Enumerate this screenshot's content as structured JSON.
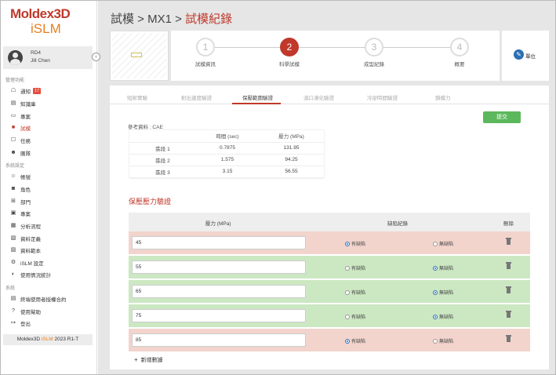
{
  "brand": {
    "line1": "Moldex3D",
    "line2": "iSLM"
  },
  "user": {
    "org": "RD4",
    "name": "Jill Chen"
  },
  "sidebar": {
    "section_management": "管理功能",
    "management_items": [
      {
        "label": "通知",
        "icon": "bell-icon",
        "badge": "17"
      },
      {
        "label": "知識庫",
        "icon": "book-icon"
      },
      {
        "label": "專案",
        "icon": "folder-icon"
      },
      {
        "label": "試模",
        "icon": "trial-icon",
        "active": true
      },
      {
        "label": "任務",
        "icon": "task-icon"
      },
      {
        "label": "團隊",
        "icon": "team-icon"
      }
    ],
    "section_system": "系統設定",
    "system_items": [
      {
        "label": "帳號",
        "icon": "account-icon"
      },
      {
        "label": "角色",
        "icon": "role-icon"
      },
      {
        "label": "部門",
        "icon": "department-icon"
      },
      {
        "label": "專案",
        "icon": "project-settings-icon"
      },
      {
        "label": "分析流程",
        "icon": "flow-icon"
      },
      {
        "label": "資料定義",
        "icon": "data-definition-icon"
      },
      {
        "label": "資料範本",
        "icon": "template-icon"
      },
      {
        "label": "iSLM 設定",
        "icon": "settings-icon"
      },
      {
        "label": "使用情況統計",
        "icon": "stats-icon"
      }
    ],
    "section_system2": "系統",
    "system2_items": [
      {
        "label": "終端使用者授權合約",
        "icon": "license-icon"
      },
      {
        "label": "使用幫助",
        "icon": "help-icon"
      },
      {
        "label": "登出",
        "icon": "logout-icon"
      }
    ],
    "version_prefix": "Moldex3D ",
    "version_brand": "iSLM",
    "version_suffix": " 2023 R1-T"
  },
  "breadcrumb": {
    "part1": "試模",
    "sep1": " > ",
    "part2": "MX1",
    "sep2": " > ",
    "current": "試模紀錄"
  },
  "steps": [
    {
      "number": "1",
      "label": "試模資訊"
    },
    {
      "number": "2",
      "label": "科學試模",
      "active": true
    },
    {
      "number": "3",
      "label": "成型紀錄"
    },
    {
      "number": "4",
      "label": "概要"
    }
  ],
  "unit_button": "單位",
  "tabs": [
    "短射實驗",
    "射出速度驗證",
    "保壓範圍驗證",
    "澆口凍化驗證",
    "冷卻時間驗證",
    "鎖模力"
  ],
  "active_tab": 2,
  "submit_label": "提交",
  "reference_label": "參考資料 : CAE",
  "ref_table": {
    "headers": [
      "",
      "時間 (sec)",
      "壓力 (MPa)"
    ],
    "rows": [
      [
        "區段 1",
        "0.7875",
        "131.95"
      ],
      [
        "區段 2",
        "1.575",
        "94.25"
      ],
      [
        "區段 3",
        "3.15",
        "56.55"
      ]
    ]
  },
  "section_title": "保壓壓力驗證",
  "pressure_table": {
    "headers": {
      "pressure": "壓力 (MPa)",
      "defect": "缺陷紀錄",
      "delete": "刪除"
    },
    "option_defect": "有缺陷",
    "option_no_defect": "無缺陷",
    "rows": [
      {
        "value": "45",
        "defect": true
      },
      {
        "value": "55",
        "defect": false
      },
      {
        "value": "65",
        "defect": false
      },
      {
        "value": "75",
        "defect": false
      },
      {
        "value": "85",
        "defect": true
      }
    ]
  },
  "add_row_label": "新增數據",
  "colors": {
    "accent": "#c0392b",
    "brand_orange": "#e67e22",
    "ok_row": "#cce8c2",
    "fail_row": "#f2d4cd",
    "submit": "#5cb85c"
  }
}
